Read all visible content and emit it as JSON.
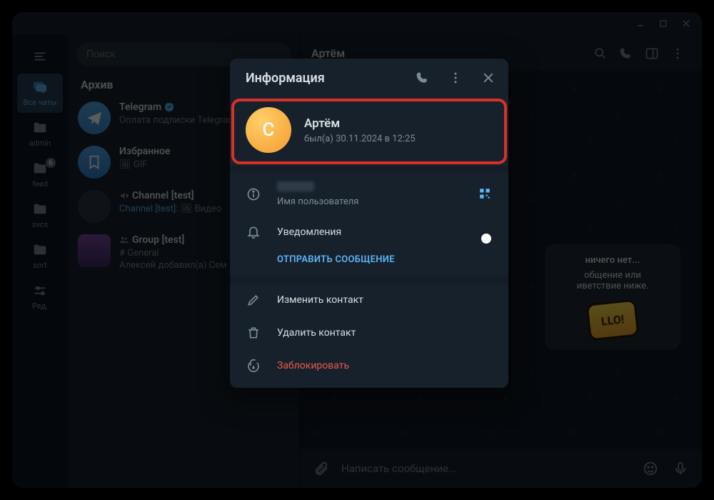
{
  "win": {
    "title_chat_name": "Артём"
  },
  "rail": {
    "items": [
      {
        "label": "Все чаты",
        "icon": "chat-bubbles-icon",
        "active": true
      },
      {
        "label": "admin",
        "icon": "folder-icon"
      },
      {
        "label": "feed",
        "icon": "folder-icon",
        "badge": "6"
      },
      {
        "label": "svcs",
        "icon": "folder-icon"
      },
      {
        "label": "sort",
        "icon": "folder-icon"
      },
      {
        "label": "Ред.",
        "icon": "equalizer-icon"
      }
    ]
  },
  "search": {
    "placeholder": "Поиск"
  },
  "archive_header": "Архив",
  "chats": [
    {
      "name": "Telegram",
      "verified": true,
      "sub1": "Оплата подписки Telegram",
      "avatar": "paper"
    },
    {
      "name": "Избранное",
      "sub1": "🖼 GIF",
      "avatar": "saved",
      "saved_icon": true
    },
    {
      "name": "Channel [test]",
      "icon": "megaphone",
      "sub1_link": "Channel [test]:",
      "sub1_rest": " 🖼 Видео",
      "avatar": "channel"
    },
    {
      "name": "Group [test]",
      "icon": "group",
      "sub1": "# General",
      "sub2": "Алексей добавил(а) Сем",
      "avatar": "group"
    }
  ],
  "chat_header": {
    "name": "Артём"
  },
  "empty": {
    "title": "ничего нет...",
    "line1": "общение или",
    "line2": "иветствие ниже.",
    "sticker": "LLO!"
  },
  "composer": {
    "placeholder": "Написать сообщение..."
  },
  "popup": {
    "title": "Информация",
    "profile": {
      "avatar_letter": "C",
      "name": "Артём",
      "seen": "был(а) 30.11.2024 в 12:25"
    },
    "username_label": "Имя пользователя",
    "notifications_label": "Уведомления",
    "send_msg": "ОТПРАВИТЬ СООБЩЕНИЕ",
    "edit_contact": "Изменить контакт",
    "delete_contact": "Удалить контакт",
    "block": "Заблокировать"
  }
}
